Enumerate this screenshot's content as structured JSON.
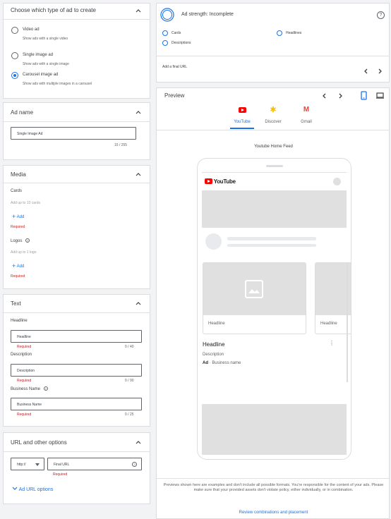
{
  "ad_type": {
    "title": "Choose which type of ad to create",
    "options": [
      {
        "label": "Video ad",
        "desc": "Show ads with a single video"
      },
      {
        "label": "Single image ad",
        "desc": "Show ads with a single image"
      },
      {
        "label": "Carousel image ad",
        "desc": "Show ads with multiple images in a carousel"
      }
    ],
    "selected_index": 2
  },
  "ad_name": {
    "title": "Ad name",
    "value": "Single Image Ad",
    "counter": "15 / 255"
  },
  "media": {
    "title": "Media",
    "cards_label": "Cards",
    "cards_hint": "Add up to 10 cards",
    "add_label": "Add",
    "required": "Required",
    "logos_label": "Logos",
    "logos_hint": "Add up to 1 logo"
  },
  "text": {
    "title": "Text",
    "headline_label": "Headline",
    "headline_placeholder": "Headline",
    "headline_counter": "0 / 40",
    "description_label": "Description",
    "description_placeholder": "Description",
    "description_counter": "0 / 90",
    "business_label": "Business Name",
    "business_placeholder": "Business Name",
    "business_counter": "0 / 25",
    "required": "Required"
  },
  "url": {
    "title": "URL and other options",
    "protocol": "http://",
    "final_url_placeholder": "Final URL",
    "required": "Required",
    "ad_url_options": "Ad URL options"
  },
  "strength": {
    "title": "Ad strength: Incomplete",
    "items": [
      "Cards",
      "Headlines",
      "Descriptions"
    ],
    "final_url_prompt": "Add a final URL"
  },
  "preview": {
    "title": "Preview",
    "tabs": [
      "YouTube",
      "Discover",
      "Gmail"
    ],
    "active_tab": 0,
    "feed_label": "Youtube Home Feed",
    "youtube_logo": "YouTube",
    "card_headline": "Headline",
    "card_headline_2": "Headline",
    "main_headline": "Headline",
    "main_description": "Description",
    "ad_badge": "Ad",
    "business_name": "Business name",
    "disclaimer": "Previews shown here are examples and don't include all possible formats. You're responsible for the content of your ads. Please make sure that your provided assets don't violate policy, either individually, or in combination.",
    "review_link": "Review combinations and placement"
  },
  "colors": {
    "accent": "#1a73e8",
    "required": "#c5221f",
    "youtube_red": "#ff0000"
  }
}
